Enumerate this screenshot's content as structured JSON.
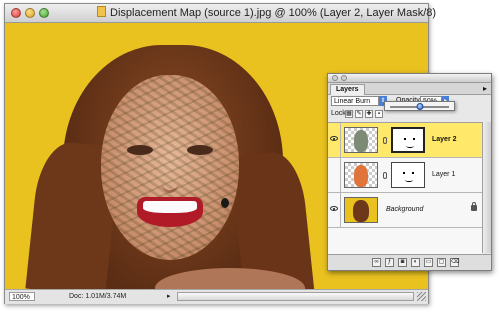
{
  "document": {
    "title": "Displacement Map (source 1).jpg @ 100% (Layer 2, Layer Mask/8)",
    "zoom": "100%",
    "doc_info": "Doc: 1.01M/3.74M"
  },
  "layers_panel": {
    "tab_label": "Layers",
    "blend_mode": "Linear Burn",
    "opacity_label": "Opacity:",
    "opacity_value": "50%",
    "opacity_fraction": 0.5,
    "lock_label": "Lock:",
    "layers": [
      {
        "name": "Layer 2",
        "visible": true,
        "selected": true
      },
      {
        "name": "Layer 1",
        "visible": false,
        "selected": false
      },
      {
        "name": "Background",
        "visible": true,
        "selected": false
      }
    ]
  },
  "colors": {
    "canvas_background": "#e9c21f",
    "selected_layer": "#ffe86a",
    "accent": "#4a7fd6"
  }
}
